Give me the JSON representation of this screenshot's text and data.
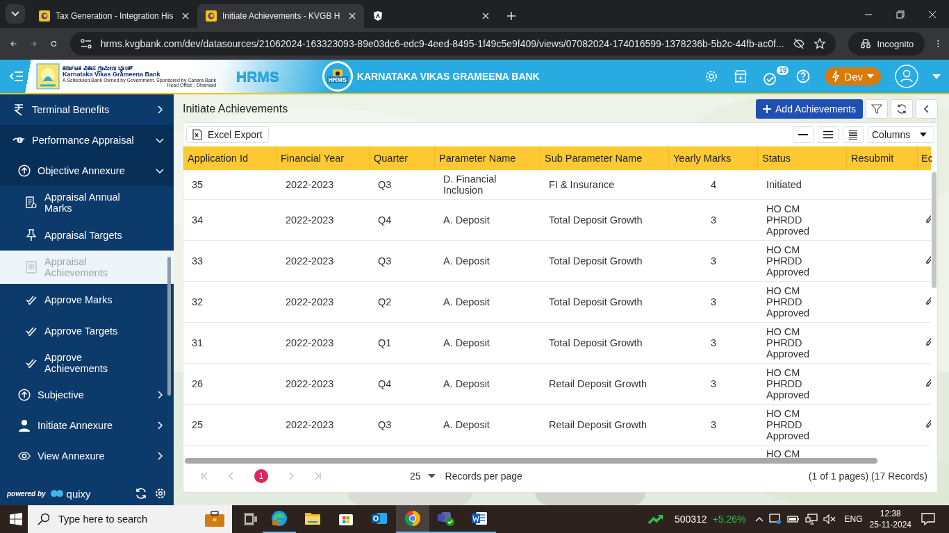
{
  "browser": {
    "tabs": [
      {
        "kind": "page",
        "title": "Tax Generation - Integration His",
        "selected": false
      },
      {
        "kind": "page",
        "title": "Initiate Achievements - KVGB H",
        "selected": true
      },
      {
        "kind": "icon",
        "selected": false
      }
    ],
    "url": "hrms.kvgbank.com/dev/datasources/21062024-163323093-89e03dc6-edc9-4eed-8495-1f49c5e9f409/views/07082024-174016599-1378236b-5b2c-44fb-ac0f...",
    "profile": "Incognito"
  },
  "app_header": {
    "bank_name_kannada": "ಕರ್ನಾಟಕ ವಿಕಾಸ ಗ್ರಾಮೀಣ ಬ್ಯಾಂಕ್",
    "bank_name": "Karnataka Vikas Grameena Bank",
    "tagline": "A Scheduled Bank Owned by Government, Sponsored by Canara Bank",
    "head_office": "Head Office : Dharwad",
    "app_name": "HRMS",
    "emblem_text": "HRMS",
    "title": "KARNATAKA VIKAS GRAMEENA BANK",
    "notification_count": "19",
    "environment": "Dev"
  },
  "sidebar": {
    "items": [
      {
        "label": "Terminal Benefits",
        "expanded": false,
        "selected": false
      },
      {
        "label": "Performance Appraisal",
        "expanded": true,
        "selected": false,
        "children": [
          {
            "label": "Objective Annexure",
            "expanded": true,
            "selected": false,
            "children": [
              {
                "label": "Appraisal Annual Marks",
                "selected": false
              },
              {
                "label": "Appraisal Targets",
                "selected": false
              },
              {
                "label": "Appraisal Achievements",
                "selected": true
              },
              {
                "label": "Approve Marks",
                "selected": false
              },
              {
                "label": "Approve Targets",
                "selected": false
              },
              {
                "label": "Approve Achievements",
                "selected": false
              }
            ]
          },
          {
            "label": "Subjective",
            "expanded": false,
            "selected": false
          },
          {
            "label": "Initiate Annexure",
            "expanded": false,
            "selected": false
          },
          {
            "label": "View Annexure",
            "expanded": false,
            "selected": false
          }
        ]
      }
    ],
    "powered_by": "powered by",
    "brand": "quixy"
  },
  "page": {
    "title": "Initiate Achievements",
    "add_button": "Add Achievements",
    "export_button": "Excel Export",
    "columns_button": "Columns",
    "table": {
      "columns": [
        "Application Id",
        "Financial Year",
        "Quarter",
        "Parameter Name",
        "Sub Parameter Name",
        "Yearly Marks",
        "Status",
        "Resubmit",
        "Ec"
      ],
      "rows": [
        {
          "application_id": "35",
          "financial_year": "2022-2023",
          "quarter": "Q3",
          "parameter": "D. Financial Inclusion",
          "sub_parameter": "FI & Insurance",
          "yearly_marks": "4",
          "status": [
            "Initiated"
          ],
          "edit": false
        },
        {
          "application_id": "34",
          "financial_year": "2022-2023",
          "quarter": "Q4",
          "parameter": "A. Deposit",
          "sub_parameter": "Total Deposit Growth",
          "yearly_marks": "3",
          "status": [
            "HO CM",
            "PHRDD",
            "Approved"
          ],
          "edit": true
        },
        {
          "application_id": "33",
          "financial_year": "2022-2023",
          "quarter": "Q3",
          "parameter": "A. Deposit",
          "sub_parameter": "Total Deposit Growth",
          "yearly_marks": "3",
          "status": [
            "HO CM",
            "PHRDD",
            "Approved"
          ],
          "edit": true
        },
        {
          "application_id": "32",
          "financial_year": "2022-2023",
          "quarter": "Q2",
          "parameter": "A. Deposit",
          "sub_parameter": "Total Deposit Growth",
          "yearly_marks": "3",
          "status": [
            "HO CM",
            "PHRDD",
            "Approved"
          ],
          "edit": true
        },
        {
          "application_id": "31",
          "financial_year": "2022-2023",
          "quarter": "Q1",
          "parameter": "A. Deposit",
          "sub_parameter": "Total Deposit Growth",
          "yearly_marks": "3",
          "status": [
            "HO CM",
            "PHRDD",
            "Approved"
          ],
          "edit": true
        },
        {
          "application_id": "26",
          "financial_year": "2022-2023",
          "quarter": "Q4",
          "parameter": "A. Deposit",
          "sub_parameter": "Retail Deposit Growth",
          "yearly_marks": "3",
          "status": [
            "HO CM",
            "PHRDD",
            "Approved"
          ],
          "edit": true
        },
        {
          "application_id": "25",
          "financial_year": "2022-2023",
          "quarter": "Q3",
          "parameter": "A. Deposit",
          "sub_parameter": "Retail Deposit Growth",
          "yearly_marks": "3",
          "status": [
            "HO CM",
            "PHRDD",
            "Approved"
          ],
          "edit": true
        },
        {
          "status": [
            "HO CM"
          ],
          "edit": false
        }
      ]
    },
    "pagination": {
      "pages": [
        {
          "label": "1",
          "selected": true
        }
      ],
      "nav_disabled": true,
      "page_size": "25",
      "per_page_label": "Records per page",
      "summary": "(1 of 1 pages) (17 Records)"
    }
  },
  "taskbar": {
    "search_placeholder": "Type here to search",
    "apps": [
      {
        "running": true
      },
      {
        "running": false
      },
      {
        "running": false
      },
      {
        "running": false
      },
      {
        "running": true
      },
      {
        "running": true
      },
      {
        "running": true
      }
    ],
    "stock_code": "500312",
    "stock_change": "+5.26%",
    "language": "ENG",
    "time": "12:38",
    "date": "25-11-2024"
  }
}
